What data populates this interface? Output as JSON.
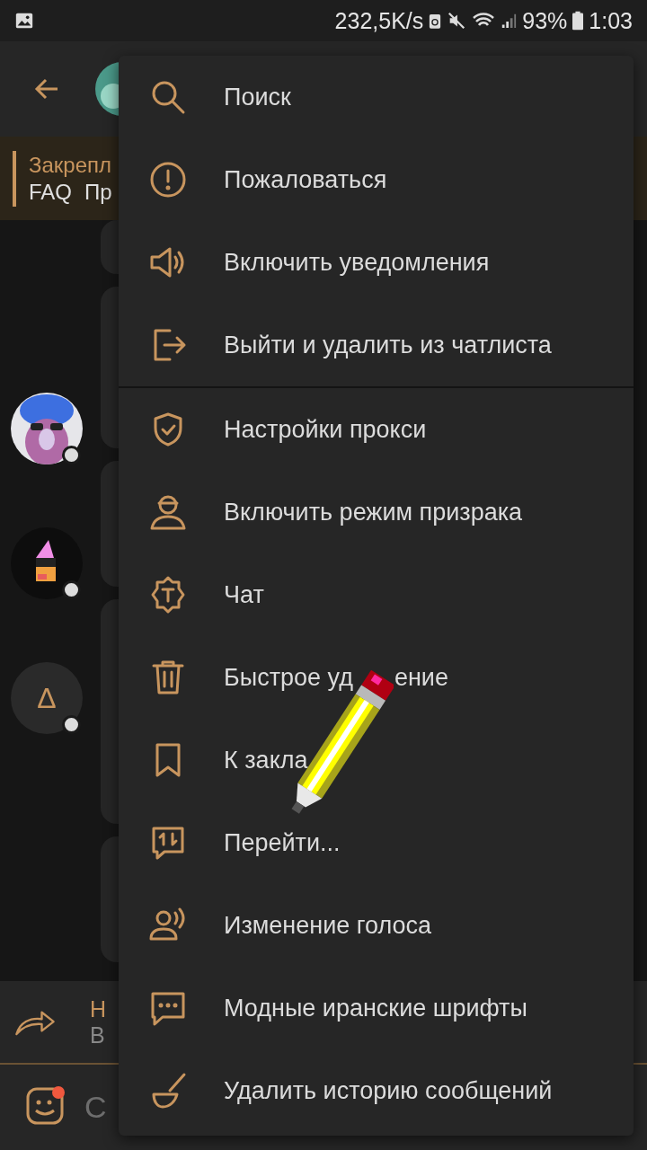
{
  "status_bar": {
    "speed": "232,5K/s",
    "battery": "93%",
    "time": "1:03"
  },
  "pinned": {
    "title": "Закрепл",
    "text_1": "FAQ",
    "text_2": "Пр"
  },
  "avatars": [
    {
      "kind": "picture"
    },
    {
      "kind": "picture"
    },
    {
      "kind": "letter",
      "letter": "Δ"
    }
  ],
  "reply": {
    "title": "Н",
    "text": "В"
  },
  "input": {
    "placeholder": "С"
  },
  "menu": [
    [
      {
        "label": "Поиск"
      },
      {
        "label": "Пожаловаться"
      },
      {
        "label": "Включить уведомления"
      },
      {
        "label": "Выйти и удалить из чатлиста"
      }
    ],
    [
      {
        "label": "Настройки прокси"
      },
      {
        "label": "Включить режим призрака"
      },
      {
        "label": "Чат"
      },
      {
        "label": "Быстрое уд",
        "label_after": "ение"
      },
      {
        "label": "К закла"
      },
      {
        "label": "Перейти..."
      },
      {
        "label": "Изменение голоса"
      },
      {
        "label": "Модные иранские шрифты"
      },
      {
        "label": "Удалить историю сообщений"
      }
    ]
  ]
}
